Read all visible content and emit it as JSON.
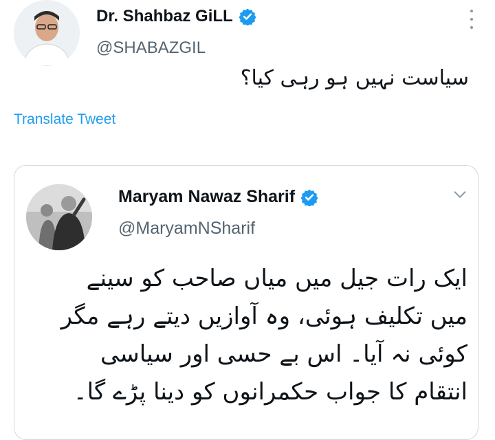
{
  "tweet": {
    "author_name": "Dr. Shahbaz GiLL",
    "author_handle": "@SHABAZGIL",
    "text": "سیاست نہیں ہو رہی کیا؟",
    "translate_label": "Translate Tweet",
    "avatar_icon": "person-photo-icon",
    "verified_icon": "verified-badge-icon",
    "more_icon": "more-options-icon"
  },
  "quoted_tweet": {
    "author_name": "Maryam Nawaz Sharif",
    "author_handle": "@MaryamNSharif",
    "lines": [
      "ایک رات جیل میں میاں صاحب کو سینے",
      "میں تکلیف ہوئی، وہ آوازیں دیتے رہے مگر",
      "کوئی نہ آیا۔ اس بے حسی اور سیاسی",
      "انتقام کا جواب حکمرانوں کو دینا پڑے گا۔"
    ],
    "avatar_icon": "person-photo-icon",
    "verified_icon": "verified-badge-icon",
    "chevron_icon": "chevron-down-icon"
  },
  "colors": {
    "accent": "#1d9bf0",
    "text": "#0f1419",
    "secondary_text": "#536471",
    "border": "#cfd9de"
  }
}
